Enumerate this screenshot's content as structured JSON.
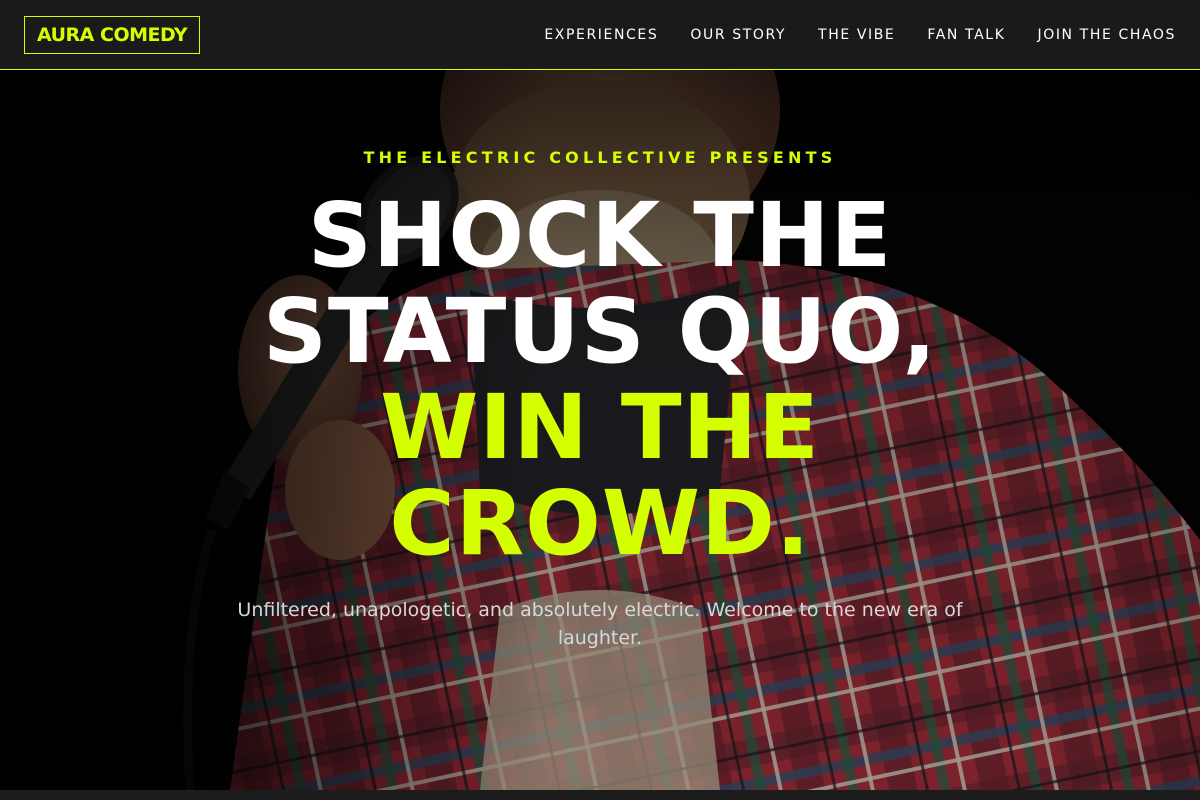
{
  "nav": {
    "logo": "AURA COMEDY",
    "links": [
      {
        "label": "EXPERIENCES"
      },
      {
        "label": "OUR STORY"
      },
      {
        "label": "THE VIBE"
      },
      {
        "label": "FAN TALK"
      },
      {
        "label": "JOIN THE CHAOS"
      }
    ]
  },
  "hero": {
    "eyebrow": "THE ELECTRIC COLLECTIVE PRESENTS",
    "headline_lines": [
      "SHOCK THE",
      "STATUS QUO,",
      "WIN THE",
      "CROWD."
    ],
    "subtext": "Unfiltered, unapologetic, and absolutely electric. Welcome to the new era of laughter.",
    "background_image": "comedian-with-microphone-photo"
  },
  "colors": {
    "accent": "#d4ff00",
    "nav_background": "#1a1a1a",
    "headline": "#ffffff",
    "subtext": "#d8d8d8"
  }
}
